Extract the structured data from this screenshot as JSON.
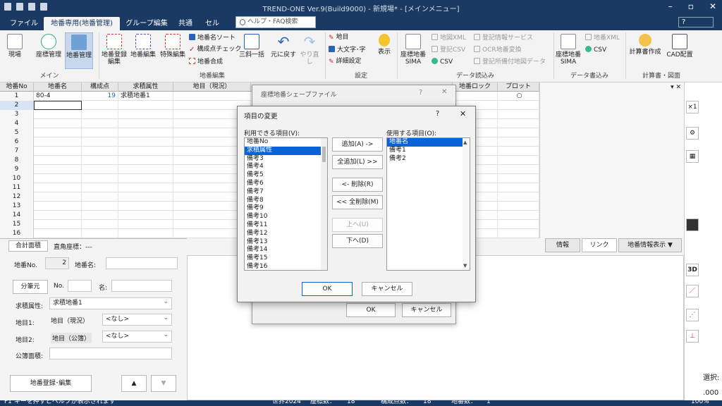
{
  "app": {
    "title": "TREND-ONE Ver.9(Build9000) - 新規場* - [メインメニュー]"
  },
  "menu": {
    "tabs": [
      "ファイル",
      "地番専用(地番管理)",
      "グループ編集",
      "共通",
      "セル"
    ],
    "help_search": "ヘルプ・FAQ検索"
  },
  "ribbon": {
    "main_group": "メイン",
    "edit_group": "地番編集",
    "settings_group": "設定",
    "read_group": "データ読込み",
    "write_group": "データ書込み",
    "calc_group": "計算書・図面",
    "genba": "現場",
    "zahyo_kanri": "座標管理",
    "chiban_kanri": "地番管理",
    "chiban_toroku": "地番登録",
    "chiban_toroku2": "編集",
    "chiban_henshu": "地番編集",
    "tokushu_henshu": "特殊編集",
    "sort": "地番名ソート",
    "check": "構成点チェック",
    "gosei": "地番合成",
    "sankaku": "三斜一括",
    "undo": "元に戻す",
    "redo": "やり直し",
    "chimoku": "地目",
    "daimoji": "大文字･字",
    "shosai": "詳細設定",
    "hyoji": "表示",
    "read_sima": "座標地番",
    "read_sima2": "SIMA",
    "chiban_xml": "地図XML",
    "toki_csv": "登記CSV",
    "csv": "CSV",
    "toki_service": "登記情報サービス",
    "ocr": "OCR地番変換",
    "toki_shoin": "登記所備付地図データ",
    "write_sima": "座標地番",
    "write_sima2": "SIMA",
    "write_xml": "地番XML",
    "write_csv": "CSV",
    "keisansho": "計算書作成",
    "cad": "CAD配置"
  },
  "grid": {
    "headers": [
      "地番No",
      "地番名",
      "構成点",
      "求積属性",
      "地目（現況）",
      "地番ロック",
      "プロット"
    ],
    "rows": [
      {
        "no": "1",
        "name": "80-4",
        "points": "19",
        "attr": "求積地番1",
        "plot": "○"
      },
      {
        "no": "2"
      },
      {
        "no": "3"
      },
      {
        "no": "4"
      },
      {
        "no": "5"
      },
      {
        "no": "6"
      },
      {
        "no": "7"
      },
      {
        "no": "8"
      },
      {
        "no": "9"
      },
      {
        "no": "10"
      },
      {
        "no": "11"
      },
      {
        "no": "12"
      },
      {
        "no": "13"
      },
      {
        "no": "14"
      },
      {
        "no": "15"
      },
      {
        "no": "16"
      }
    ]
  },
  "bottom": {
    "tab": "合計面積",
    "coord": "直角座標：---",
    "chiban_no_label": "地番No.",
    "chiban_no": "2",
    "chiban_name_label": "地番名:",
    "bunpitsu": "分筆元",
    "no_label": "No.",
    "mei_label": "名:",
    "attr_label": "求積属性:",
    "attr_value": "求積地番1",
    "chimoku1_label": "地目1:",
    "chimoku1_type": "地目（現況）",
    "chimoku1_value": "<なし>",
    "chimoku2_label": "地目2:",
    "chimoku2_type": "地目（公簿）",
    "chimoku2_value": "<なし>",
    "kobo_label": "公簿面積:",
    "reg_button": "地番登録･編集",
    "up": "▲",
    "down": "▼",
    "info_tab": "情報",
    "link_tab": "リンク",
    "display_tab": "地番情報表示 ▼"
  },
  "bg_dialog": {
    "title": "座標地番シェープファイル",
    "ok": "OK",
    "cancel": "キャンセル"
  },
  "dialog": {
    "title": "項目の変更",
    "available_label": "利用できる項目(V):",
    "used_label": "使用する項目(O):",
    "available": [
      "地番No",
      "求積属性",
      "備考3",
      "備考4",
      "備考5",
      "備考6",
      "備考7",
      "備考8",
      "備考9",
      "備考10",
      "備考11",
      "備考12",
      "備考13",
      "備考14",
      "備考15",
      "備考16"
    ],
    "used": [
      "地番名",
      "備考1",
      "備考2"
    ],
    "add": "追加(A) ->",
    "add_all": "全追加(L) >>",
    "remove": "<- 削除(R)",
    "remove_all": "<< 全削除(M)",
    "up": "上へ(U)",
    "down": "下へ(D)",
    "ok": "OK",
    "cancel": "キャンセル",
    "help": "?",
    "close": "✕"
  },
  "status": {
    "text": "F1 キーを押すとヘルプが表示されます",
    "mode": "世界2024",
    "zahyo_label": "座標数：",
    "zahyo": "18",
    "kosei_label": "構成点数：",
    "kosei": "18",
    "chiban_label": "地番数：",
    "chiban": "1",
    "zoom": "100%"
  },
  "right": {
    "sentaku": "選択:",
    "value": ".000"
  },
  "colors": {
    "titlebar": "#1b3a63",
    "selection": "#0a64d8"
  }
}
